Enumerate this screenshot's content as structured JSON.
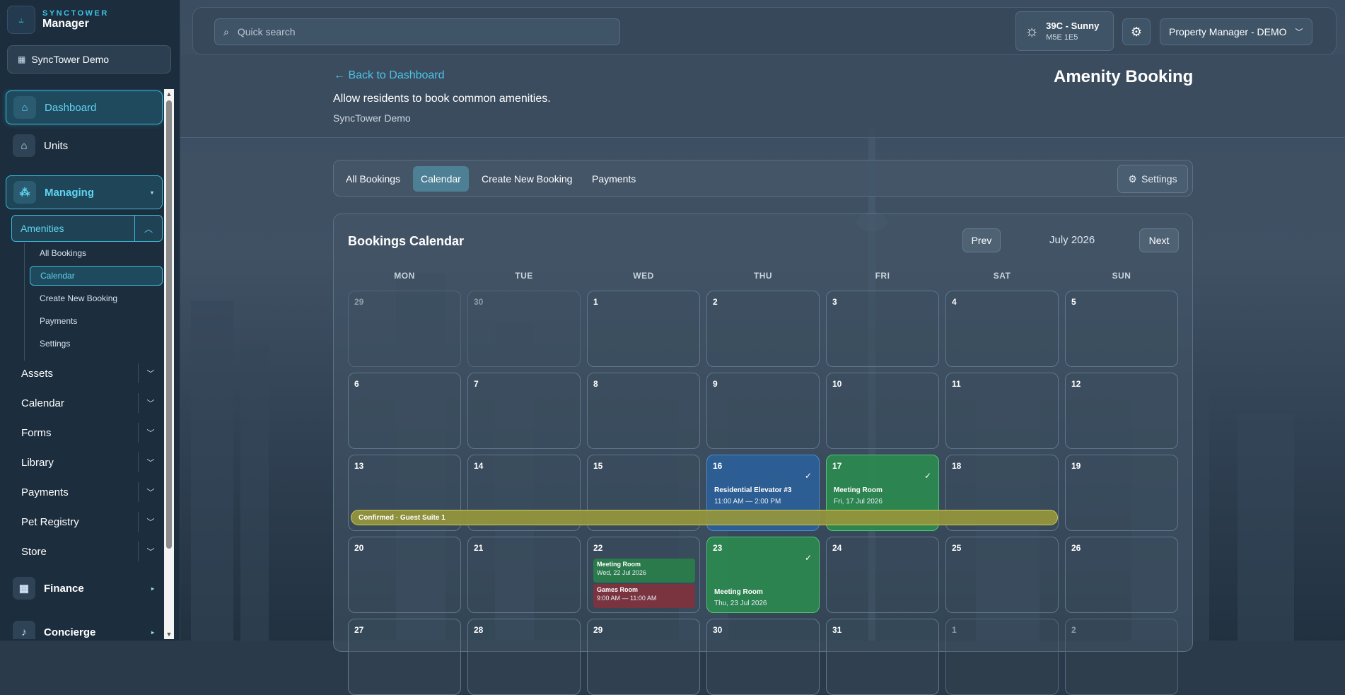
{
  "app": {
    "brand": "SYNCTOWER",
    "name": "Manager",
    "org_button": "SyncTower Demo"
  },
  "sidebar": {
    "items": [
      {
        "label": "Dashboard",
        "icon": "home-icon"
      },
      {
        "label": "Units",
        "icon": "home-icon"
      },
      {
        "label": "Managing",
        "icon": "cluster-icon"
      }
    ],
    "amenities": {
      "label": "Amenities",
      "sub": [
        "All Bookings",
        "Calendar",
        "Create New Booking",
        "Payments",
        "Settings"
      ]
    },
    "sections": [
      "Assets",
      "Calendar",
      "Forms",
      "Library",
      "Payments",
      "Pet Registry",
      "Store"
    ],
    "groups": [
      {
        "label": "Finance",
        "icon": "building-icon"
      },
      {
        "label": "Concierge",
        "icon": "bell-icon"
      }
    ]
  },
  "topbar": {
    "search_placeholder": "Quick search",
    "weather": {
      "temp": "39C - Sunny",
      "postal": "M5E 1E5"
    },
    "role": "Property Manager - DEMO"
  },
  "page": {
    "back": "Back to Dashboard",
    "title": "Amenity Booking",
    "description": "Allow residents to book common amenities.",
    "org": "SyncTower Demo"
  },
  "tabs": {
    "items": [
      "All Bookings",
      "Calendar",
      "Create New Booking",
      "Payments"
    ],
    "settings": "Settings"
  },
  "calendar": {
    "title": "Bookings Calendar",
    "prev": "Prev",
    "next": "Next",
    "month": "July 2026",
    "weekdays": [
      "MON",
      "TUE",
      "WED",
      "THU",
      "FRI",
      "SAT",
      "SUN"
    ],
    "weeks": [
      [
        "29",
        "30",
        "1",
        "2",
        "3",
        "4",
        "5"
      ],
      [
        "6",
        "7",
        "8",
        "9",
        "10",
        "11",
        "12"
      ],
      [
        "13",
        "14",
        "15",
        "16",
        "17",
        "18",
        "19"
      ],
      [
        "20",
        "21",
        "22",
        "23",
        "24",
        "25",
        "26"
      ],
      [
        "27",
        "28",
        "29",
        "30",
        "31",
        "1",
        "2"
      ]
    ],
    "events": {
      "d16": {
        "title": "Residential Elevator #3",
        "time": "11:00 AM — 2:00 PM"
      },
      "d17": {
        "title": "Meeting Room",
        "date": "Fri, 17 Jul 2026"
      },
      "d22a": {
        "title": "Meeting Room",
        "date": "Wed, 22 Jul 2026"
      },
      "d22b": {
        "title": "Games Room",
        "time": "9:00 AM — 11:00 AM"
      },
      "d23": {
        "title": "Meeting Room",
        "date": "Thu, 23 Jul 2026"
      },
      "span": "Confirmed · Guest Suite 1"
    },
    "colors": {
      "blue": "#2961a0",
      "green": "#2a8e4d",
      "yellow": "#96963c",
      "red": "#7a3440"
    }
  }
}
